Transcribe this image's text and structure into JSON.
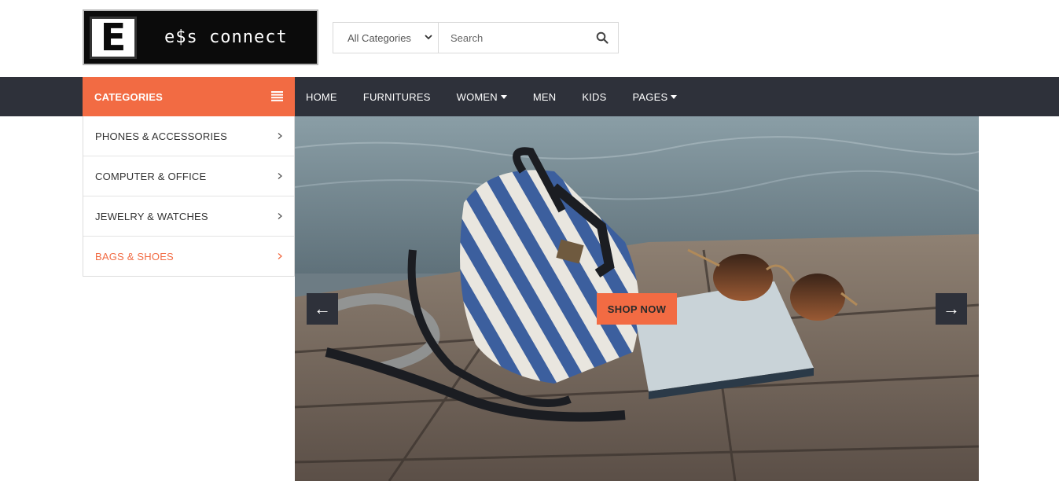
{
  "logo": {
    "mark": "E",
    "text": "e$s connect"
  },
  "search": {
    "category_selected": "All Categories",
    "placeholder": "Search",
    "icon": "search-icon"
  },
  "navbar": {
    "categories_label": "CATEGORIES",
    "items": [
      {
        "label": "HOME",
        "dropdown": false
      },
      {
        "label": "FURNITURES",
        "dropdown": false
      },
      {
        "label": "WOMEN",
        "dropdown": true
      },
      {
        "label": "MEN",
        "dropdown": false
      },
      {
        "label": "KIDS",
        "dropdown": false
      },
      {
        "label": "PAGES",
        "dropdown": true
      }
    ]
  },
  "sidebar": {
    "items": [
      {
        "label": "PHONES & ACCESSORIES"
      },
      {
        "label": "COMPUTER & OFFICE"
      },
      {
        "label": "JEWELRY & WATCHES"
      },
      {
        "label": "BAGS & SHOES"
      }
    ]
  },
  "hero": {
    "prev_label": "←",
    "next_label": "→",
    "cta_label": "SHOP NOW"
  },
  "colors": {
    "accent": "#f26b43",
    "navbar": "#2e313a",
    "logo_bg": "#0b0b0b"
  }
}
